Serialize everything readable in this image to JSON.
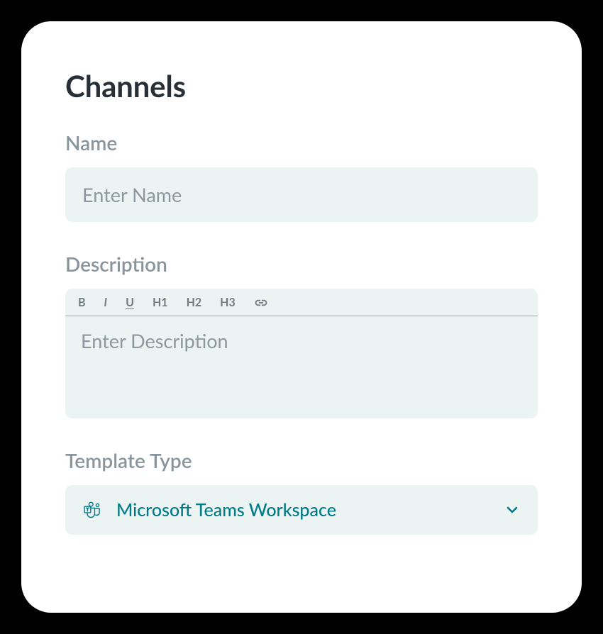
{
  "title": "Channels",
  "fields": {
    "name": {
      "label": "Name",
      "placeholder": "Enter Name",
      "value": ""
    },
    "description": {
      "label": "Description",
      "placeholder": "Enter Description",
      "value": "",
      "toolbar": {
        "bold": "B",
        "italic": "I",
        "underline": "U",
        "h1": "H1",
        "h2": "H2",
        "h3": "H3"
      }
    },
    "templateType": {
      "label": "Template Type",
      "selected": "Microsoft Teams Workspace"
    }
  },
  "colors": {
    "accent": "#007a87",
    "fieldBg": "#ecf3f3",
    "labelMuted": "#88959d",
    "titleDark": "#282f36"
  }
}
